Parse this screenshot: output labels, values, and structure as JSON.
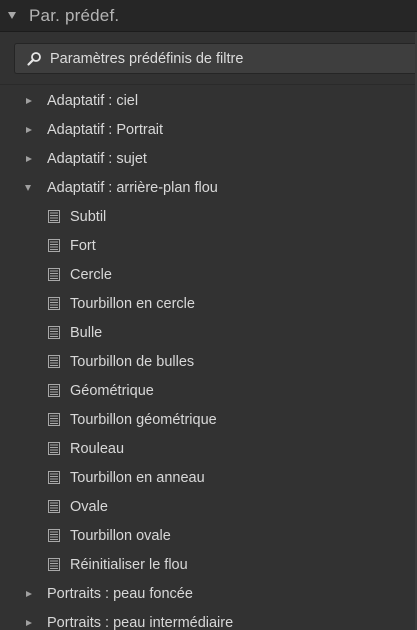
{
  "panel": {
    "title": "Par. prédef.",
    "collapse_icon": "triangle-down-icon"
  },
  "search": {
    "placeholder": "Paramètres prédéfinis de filtre",
    "icon": "magnifier-icon"
  },
  "tree": {
    "folders_top": [
      {
        "label": "Adaptatif : ciel",
        "expanded": false
      },
      {
        "label": "Adaptatif : Portrait",
        "expanded": false
      },
      {
        "label": "Adaptatif : sujet",
        "expanded": false
      },
      {
        "label": "Adaptatif : arrière-plan flou",
        "expanded": true
      }
    ],
    "presets": [
      {
        "label": "Subtil"
      },
      {
        "label": "Fort"
      },
      {
        "label": "Cercle"
      },
      {
        "label": "Tourbillon en cercle"
      },
      {
        "label": "Bulle"
      },
      {
        "label": "Tourbillon de bulles"
      },
      {
        "label": "Géométrique"
      },
      {
        "label": "Tourbillon géométrique"
      },
      {
        "label": "Rouleau"
      },
      {
        "label": "Tourbillon en anneau"
      },
      {
        "label": "Ovale"
      },
      {
        "label": "Tourbillon ovale"
      },
      {
        "label": "Réinitialiser le flou"
      }
    ],
    "folders_bottom": [
      {
        "label": "Portraits : peau foncée",
        "expanded": false
      },
      {
        "label": "Portraits : peau intermédiaire",
        "expanded": false
      }
    ]
  },
  "colors": {
    "panel_bg": "#323232",
    "header_bg": "#262626",
    "text": "#d8d8d8"
  }
}
